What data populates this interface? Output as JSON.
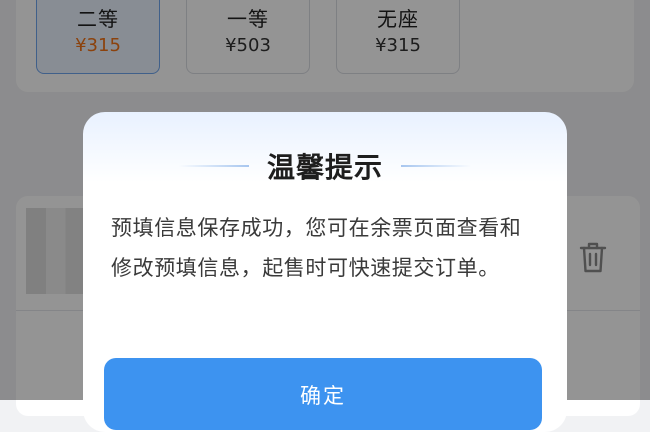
{
  "seat_options": [
    {
      "name": "二等",
      "price": "¥315",
      "selected": true
    },
    {
      "name": "一等",
      "price": "¥503",
      "selected": false
    },
    {
      "name": "无座",
      "price": "¥315",
      "selected": false
    }
  ],
  "dialog": {
    "title": "温馨提示",
    "message": "预填信息保存成功，您可在余票页面查看和修改预填信息，起售时可快速提交订单。",
    "confirm_label": "确定"
  },
  "colors": {
    "accent": "#3d93f0",
    "price_highlight": "#f07318",
    "selected_border": "#6fa5ee"
  }
}
